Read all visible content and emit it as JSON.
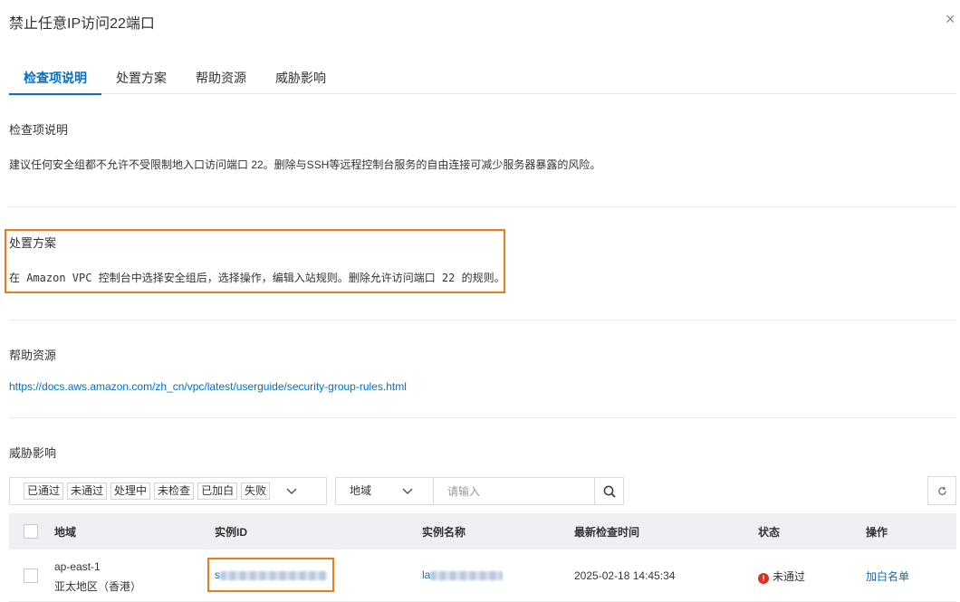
{
  "dialog": {
    "title": "禁止任意IP访问22端口"
  },
  "tabs": [
    {
      "label": "检查项说明",
      "active": true
    },
    {
      "label": "处置方案",
      "active": false
    },
    {
      "label": "帮助资源",
      "active": false
    },
    {
      "label": "威胁影响",
      "active": false
    }
  ],
  "sections": {
    "description": {
      "heading": "检查项说明",
      "text": "建议任何安全组都不允许不受限制地入口访问端口 22。删除与SSH等远程控制台服务的自由连接可减少服务器暴露的风险。"
    },
    "remediation": {
      "heading": "处置方案",
      "text": "在 Amazon VPC 控制台中选择安全组后，选择操作，编辑入站规则。删除允许访问端口 22 的规则。"
    },
    "help": {
      "heading": "帮助资源",
      "link": "https://docs.aws.amazon.com/zh_cn/vpc/latest/userguide/security-group-rules.html"
    },
    "impact": {
      "heading": "威胁影响"
    }
  },
  "filters": {
    "status_chips": [
      "已通过",
      "未通过",
      "处理中",
      "未检查",
      "已加白",
      "失败"
    ],
    "region_label": "地域",
    "search_placeholder": "请输入"
  },
  "table": {
    "columns": [
      "地域",
      "实例ID",
      "实例名称",
      "最新检查时间",
      "状态",
      "操作"
    ],
    "rows": [
      {
        "region_code": "ap-east-1",
        "region_name": "亚太地区（香港）",
        "instance_id_prefix": "s",
        "instance_name_prefix": "la",
        "last_check": "2025-02-18 14:45:34",
        "status": "未通过",
        "action": "加白名单"
      }
    ]
  },
  "colors": {
    "accent": "#0070cc",
    "highlight": "#f07a16",
    "error": "#d93026"
  },
  "icons": [
    "close-icon",
    "chevron-down-icon",
    "search-icon",
    "refresh-icon",
    "error-icon"
  ]
}
